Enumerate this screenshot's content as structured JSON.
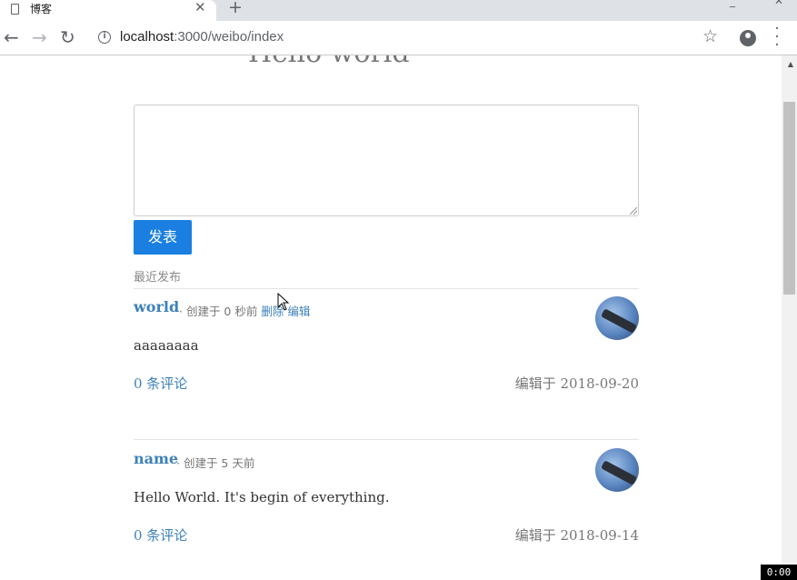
{
  "browser": {
    "tab_title": "博客",
    "url_host": "localhost",
    "url_rest": ":3000/weibo/index"
  },
  "page": {
    "heading": "Hello world",
    "composer_placeholder": "",
    "post_button": "发表",
    "recent_label": "最近发布"
  },
  "posts": [
    {
      "author": "world",
      "created": "· 创建于 0 秒前",
      "delete": "删除",
      "edit": "编辑",
      "content": "aaaaaaaa",
      "comments": "0 条评论",
      "edited": "编辑于 2018-09-20"
    },
    {
      "author": "name",
      "created": "· 创建于 5 天前",
      "content": "Hello World. It's begin of everything.",
      "comments": "0 条评论",
      "edited": "编辑于 2018-09-14"
    }
  ],
  "timer": "0:00",
  "colors": {
    "link": "#3d81b8",
    "button": "#1a7fe0"
  }
}
